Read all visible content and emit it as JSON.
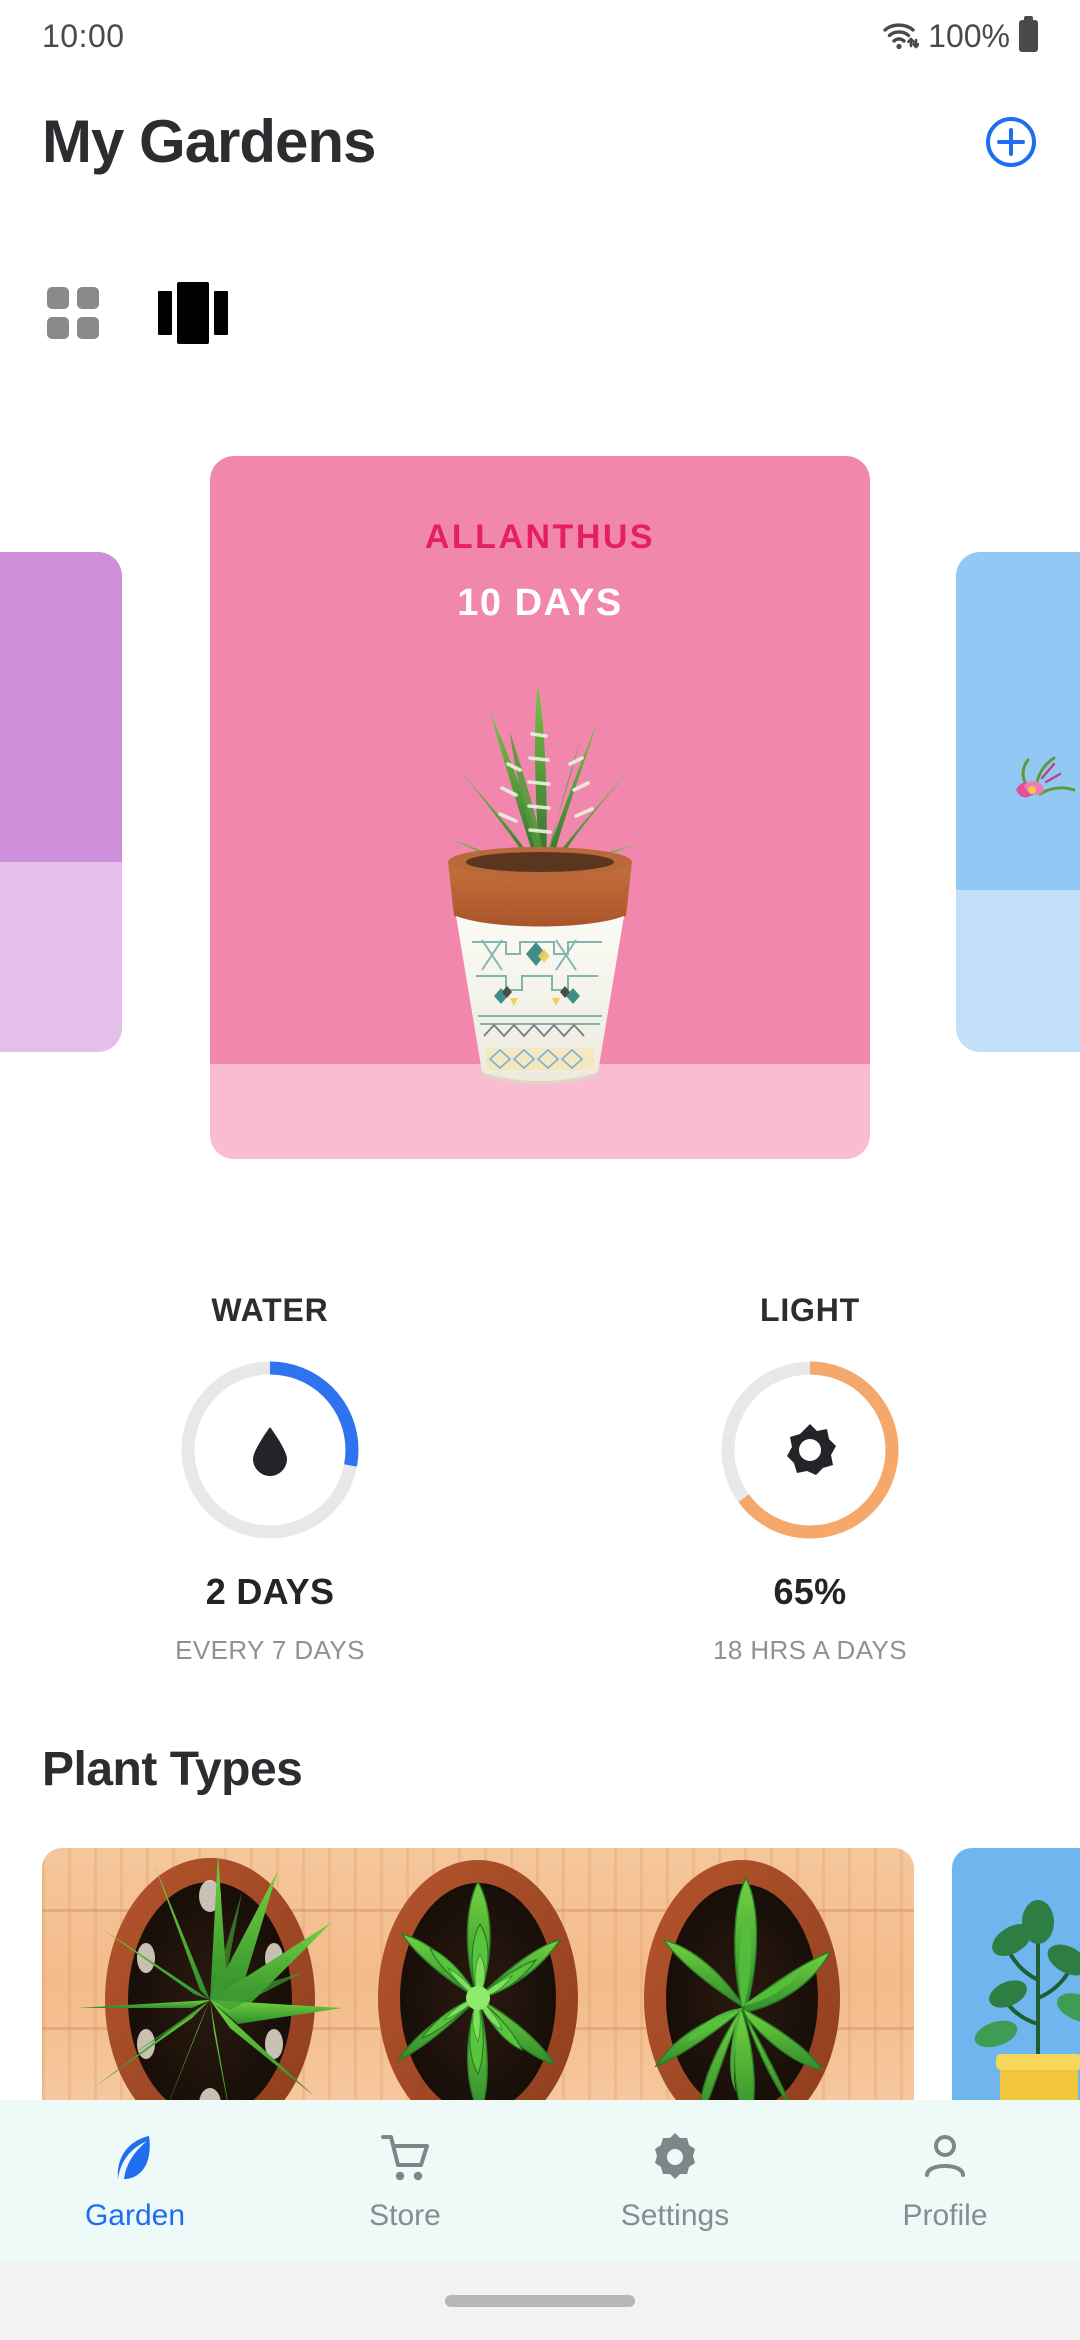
{
  "status_bar": {
    "time": "10:00",
    "wifi_icon": "wifi-icon",
    "battery_percent": "100%",
    "battery_icon": "battery-full-icon"
  },
  "header": {
    "title": "My Gardens",
    "add_icon": "plus-circle-icon",
    "accent_color": "#1f6df0"
  },
  "view_toggle": {
    "grid_icon": "grid-view-icon",
    "carousel_icon": "carousel-view-icon",
    "active": "carousel",
    "inactive_color": "#8a8a8a",
    "active_color": "#000000"
  },
  "garden_carousel": {
    "cards": [
      {
        "id": "peek-left",
        "name": "",
        "age": "",
        "top_color": "#cd8fd9",
        "bottom_color": "#e3bfe9",
        "name_color": "#9c2f9f"
      },
      {
        "id": "main",
        "name": "ALLANTHUS",
        "age": "10 DAYS",
        "top_color": "#f287ad",
        "bottom_color": "#f9bcd0",
        "name_color": "#e61e63",
        "plant_art": "succulent-in-patterned-pot"
      },
      {
        "id": "peek-right",
        "name": "",
        "age": "",
        "top_color": "#92c9f4",
        "bottom_color": "#c2e0fa",
        "name_color": "#1f6df0"
      }
    ]
  },
  "stats": [
    {
      "label": "WATER",
      "icon": "water-drop-icon",
      "value": "2 DAYS",
      "sub": "EVERY 7 DAYS",
      "percent": 28,
      "arc_color": "#2f73f0",
      "track_color": "#e8e8e8"
    },
    {
      "label": "LIGHT",
      "icon": "sun-icon",
      "value": "65%",
      "sub": "18 HRS A DAYS",
      "percent": 65,
      "arc_color": "#f6a86a",
      "track_color": "#e8e8e8"
    }
  ],
  "plant_types": {
    "title": "Plant Types",
    "cards": [
      {
        "id": "wooden-tray-succulents",
        "art": "three-potted-succulents-on-wood"
      },
      {
        "id": "blue-plant-peek",
        "art": "potted-plant-blue-background",
        "bg_color": "#6fb5ee"
      }
    ]
  },
  "bottom_nav": {
    "active_index": 0,
    "background": "#eefaf7",
    "active_color": "#1f6df0",
    "inactive_color": "#868d90",
    "items": [
      {
        "label": "Garden",
        "icon": "leaf-feather-icon"
      },
      {
        "label": "Store",
        "icon": "shopping-cart-icon"
      },
      {
        "label": "Settings",
        "icon": "gear-icon"
      },
      {
        "label": "Profile",
        "icon": "person-icon"
      }
    ]
  }
}
